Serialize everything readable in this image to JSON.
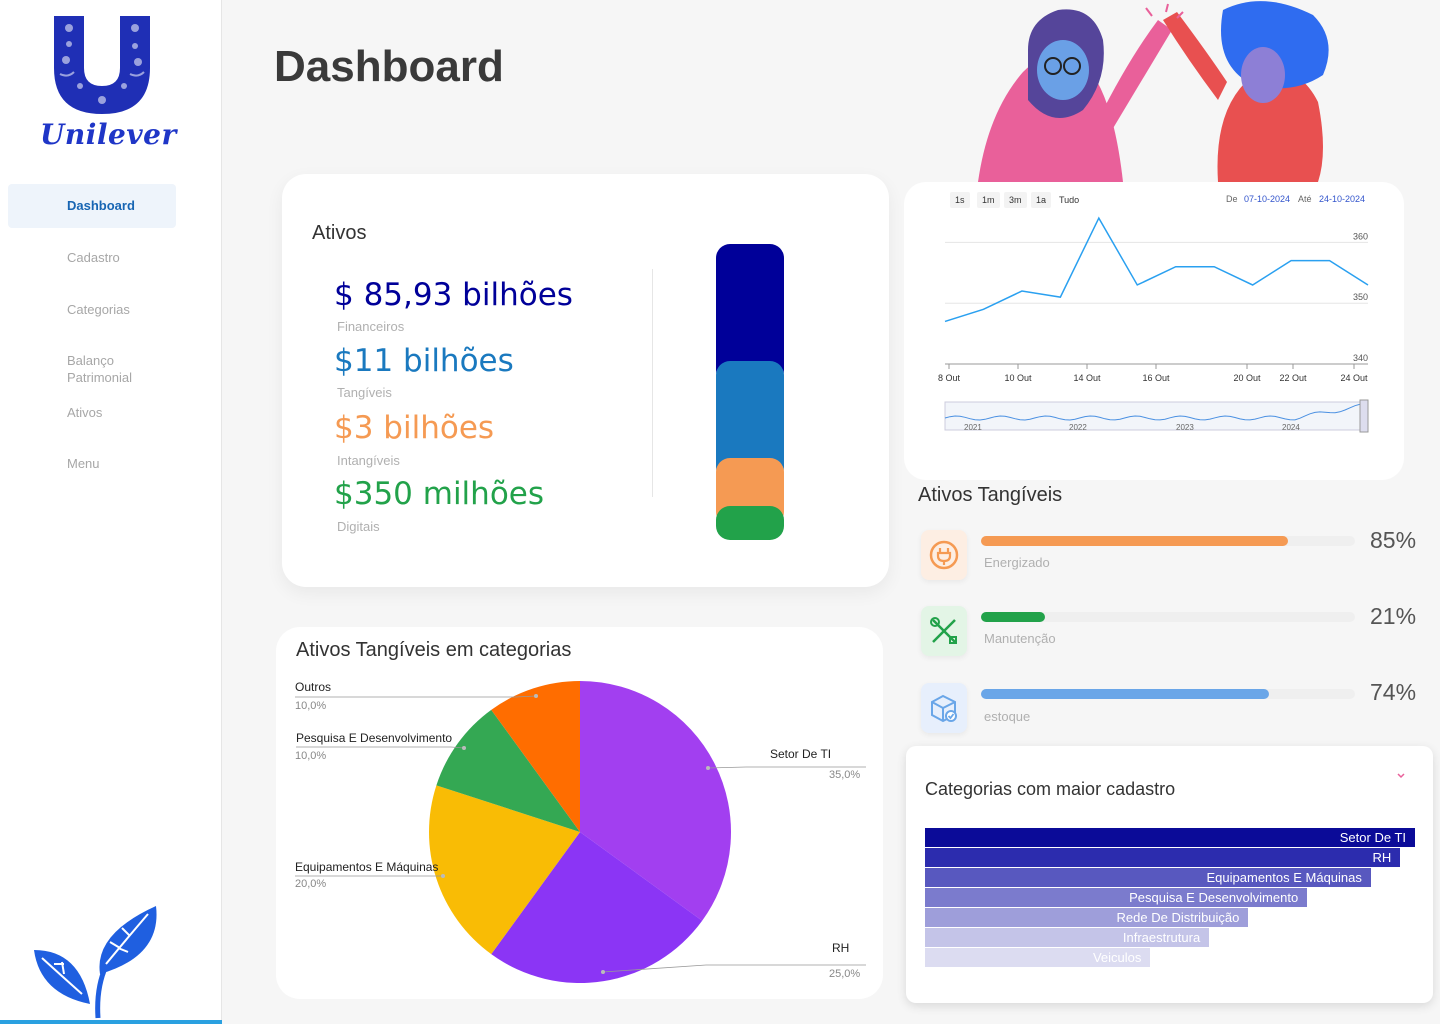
{
  "sidebar": {
    "brand": "Unilever",
    "items": [
      {
        "label": "Dashboard",
        "active": true
      },
      {
        "label": "Cadastro"
      },
      {
        "label": "Categorias"
      },
      {
        "label": "Balanço Patrimonial"
      },
      {
        "label": "Ativos"
      },
      {
        "label": "Menu"
      }
    ]
  },
  "page": {
    "title": "Dashboard"
  },
  "ativos": {
    "title": "Ativos",
    "items": [
      {
        "value": "$ 85,93 bilhões",
        "label": "Financeiros",
        "color": "#000099"
      },
      {
        "value": "$11 bilhões",
        "label": "Tangíveis",
        "color": "#1a79bf"
      },
      {
        "value": "$3 bilhões",
        "label": "Intangíveis",
        "color": "#f59a53"
      },
      {
        "value": "$350 milhões",
        "label": "Digitais",
        "color": "#22a24a"
      }
    ]
  },
  "line_chart": {
    "range_buttons": [
      "1s",
      "1m",
      "3m",
      "1a",
      "Tudo"
    ],
    "from_label": "De",
    "from_date": "07-10-2024",
    "to_label": "Até",
    "to_date": "24-10-2024",
    "y_ticks": [
      "360",
      "350",
      "340"
    ],
    "x_ticks": [
      "8 Out",
      "10 Out",
      "14 Out",
      "16 Out",
      "20 Out",
      "22 Out",
      "24 Out"
    ],
    "navigator_years": [
      "2021",
      "2022",
      "2023",
      "2024"
    ]
  },
  "tangiveis": {
    "title": "Ativos Tangíveis",
    "items": [
      {
        "label": "Energizado",
        "pct": "85%",
        "fraction": 0.82,
        "color": "#f59a53",
        "icon": "plug-icon"
      },
      {
        "label": "Manutenção",
        "pct": "21%",
        "fraction": 0.17,
        "color": "#22a24a",
        "icon": "tools-icon"
      },
      {
        "label": "estoque",
        "pct": "74%",
        "fraction": 0.77,
        "color": "#6aa6e8",
        "icon": "box-icon"
      }
    ]
  },
  "pie": {
    "title": "Ativos Tangíveis em categorias",
    "slices": [
      {
        "label": "Setor De  TI",
        "pct": "35,0%",
        "value": 35,
        "color": "#a23ff0"
      },
      {
        "label": "RH",
        "pct": "25,0%",
        "value": 25,
        "color": "#8b35f5"
      },
      {
        "label": "Equipamentos E Máquinas",
        "pct": "20,0%",
        "value": 20,
        "color": "#f9bc05"
      },
      {
        "label": "Pesquisa E Desenvolvimento",
        "pct": "10,0%",
        "value": 10,
        "color": "#34a853"
      },
      {
        "label": "Outros",
        "pct": "10,0%",
        "value": 10,
        "color": "#ff6d00"
      }
    ]
  },
  "bars": {
    "title": "Categorias com maior cadastro",
    "items": [
      {
        "label": "Setor De  TI",
        "color": "#0b0b98"
      },
      {
        "label": "RH",
        "color": "#2c2cae"
      },
      {
        "label": "Equipamentos E Máquinas",
        "color": "#5858bf"
      },
      {
        "label": "Pesquisa E Desenvolvimento",
        "color": "#7b7bcd"
      },
      {
        "label": "Rede De Distribuição",
        "color": "#9e9eda"
      },
      {
        "label": "Infraestrutura",
        "color": "#c4c4e8"
      },
      {
        "label": "Veiculos",
        "color": "#dcdcf1"
      }
    ]
  },
  "chart_data": [
    {
      "type": "line",
      "x": [
        "8 Out",
        "10 Out",
        "14 Out",
        "16 Out",
        "20 Out",
        "22 Out",
        "24 Out"
      ],
      "series": [
        {
          "values": [
            347,
            349,
            352,
            351,
            364,
            353,
            356,
            356,
            353,
            357,
            357,
            353
          ]
        }
      ],
      "ylim": [
        340,
        365
      ],
      "xlabel": "",
      "ylabel": ""
    },
    {
      "type": "pie",
      "categories": [
        "Setor De  TI",
        "RH",
        "Equipamentos E Máquinas",
        "Pesquisa E Desenvolvimento",
        "Outros"
      ],
      "values": [
        35,
        25,
        20,
        10,
        10
      ],
      "title": "Ativos Tangíveis em categorias"
    },
    {
      "type": "bar",
      "categories": [
        "Setor De  TI",
        "RH",
        "Equipamentos E Máquinas",
        "Pesquisa E Desenvolvimento",
        "Rede De Distribuição",
        "Infraestrutura",
        "Veiculos"
      ],
      "values": [
        100,
        97,
        91,
        78,
        66,
        58,
        46
      ],
      "title": "Categorias com maior cadastro"
    }
  ]
}
